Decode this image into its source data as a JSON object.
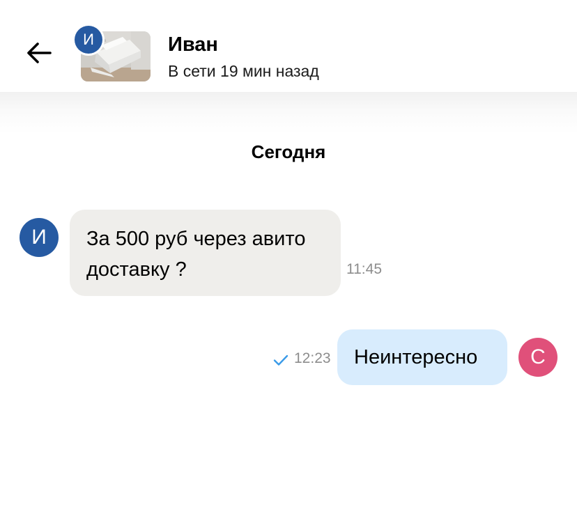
{
  "colors": {
    "avatar_ivan": "#265aa2",
    "avatar_self": "#e0507a",
    "incoming_bubble": "#efeeeb",
    "outgoing_bubble": "#d8ecfd",
    "read_check": "#3a9be8",
    "timestamp": "#8d8d8d"
  },
  "header": {
    "back_icon": "arrow-left-icon",
    "avatar_letter": "И",
    "contact_name": "Иван",
    "contact_status": "В сети 19 мин назад"
  },
  "chat": {
    "date_separator": "Сегодня",
    "messages": [
      {
        "direction": "incoming",
        "avatar_letter": "И",
        "text": "За 500 руб через авито доставку ?",
        "time": "11:45"
      },
      {
        "direction": "outgoing",
        "avatar_letter": "С",
        "text": "Неинтересно",
        "time": "12:23",
        "status_icon": "check-icon"
      }
    ]
  }
}
